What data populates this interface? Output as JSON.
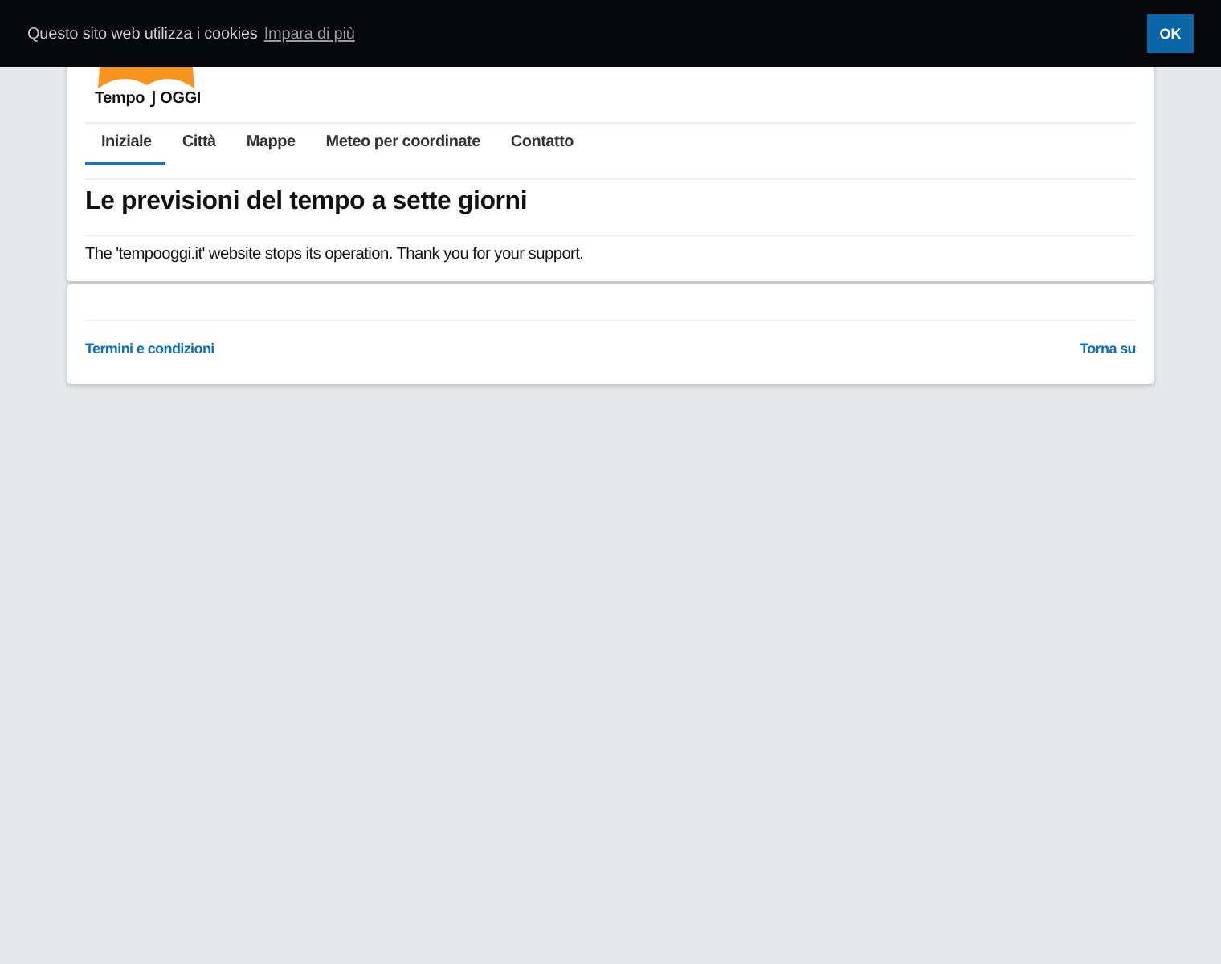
{
  "cookie_banner": {
    "message": "Questo sito web utilizza i cookies",
    "link": "Impara di più",
    "button": "OK"
  },
  "logo": {
    "word_1": "Tempo",
    "word_2": "OGGI"
  },
  "nav": [
    {
      "label": "Iniziale",
      "selected": true
    },
    {
      "label": "Città",
      "selected": false
    },
    {
      "label": "Mappe",
      "selected": false
    },
    {
      "label": "Meteo per coordinate",
      "selected": false
    },
    {
      "label": "Contatto",
      "selected": false
    }
  ],
  "heading": "Le previsioni del tempo a sette giorni",
  "notice": "The 'tempooggi.it' website stops its operation. Thank you for your support.",
  "footer": {
    "links": [
      {
        "label": "Termini e condizioni"
      },
      {
        "label": "Torna su"
      }
    ]
  }
}
